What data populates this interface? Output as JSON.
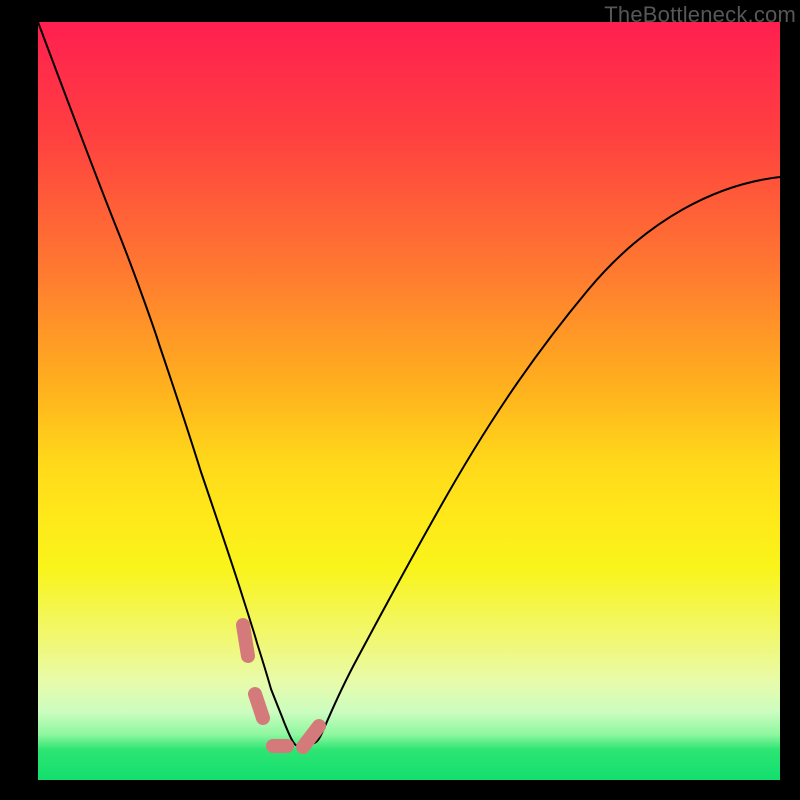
{
  "watermark": "TheBottleneck.com",
  "colors": {
    "frame": "#000000",
    "gradient_top": "#ff1f50",
    "gradient_mid": "#ffd81a",
    "gradient_bottom": "#12df6e",
    "curve": "#000000",
    "marker": "#d57a7a"
  },
  "chart_data": {
    "type": "line",
    "title": "",
    "xlabel": "",
    "ylabel": "",
    "xlim": [
      0,
      100
    ],
    "ylim": [
      0,
      100
    ],
    "series": [
      {
        "name": "bottleneck-curve",
        "x": [
          0,
          5.5,
          11,
          16.3,
          21.3,
          25,
          27.7,
          29.5,
          31.4,
          33.5,
          35.8,
          38.5,
          43,
          48,
          54,
          62,
          74,
          88,
          100
        ],
        "y": [
          100,
          86,
          72,
          57,
          41,
          28,
          18,
          11,
          4.8,
          4.5,
          4.3,
          7,
          16,
          27,
          38,
          49,
          62,
          72,
          79
        ],
        "note": "Single V-shaped bottleneck curve. y-axis is bottleneck percentage (100 top, 0 bottom). Minimum near x≈33 at ~4.3%."
      }
    ],
    "annotations": [
      {
        "name": "bottom-marker",
        "x": [
          27.6,
          28.3,
          29.2,
          30.4,
          31.6,
          33.5,
          35.7,
          37.8
        ],
        "y": [
          20.5,
          16.4,
          11.3,
          7.2,
          4.5,
          4.5,
          4.3,
          7.2
        ],
        "note": "Dashed/segmented pink highlight over the curve's minimum region."
      }
    ]
  }
}
